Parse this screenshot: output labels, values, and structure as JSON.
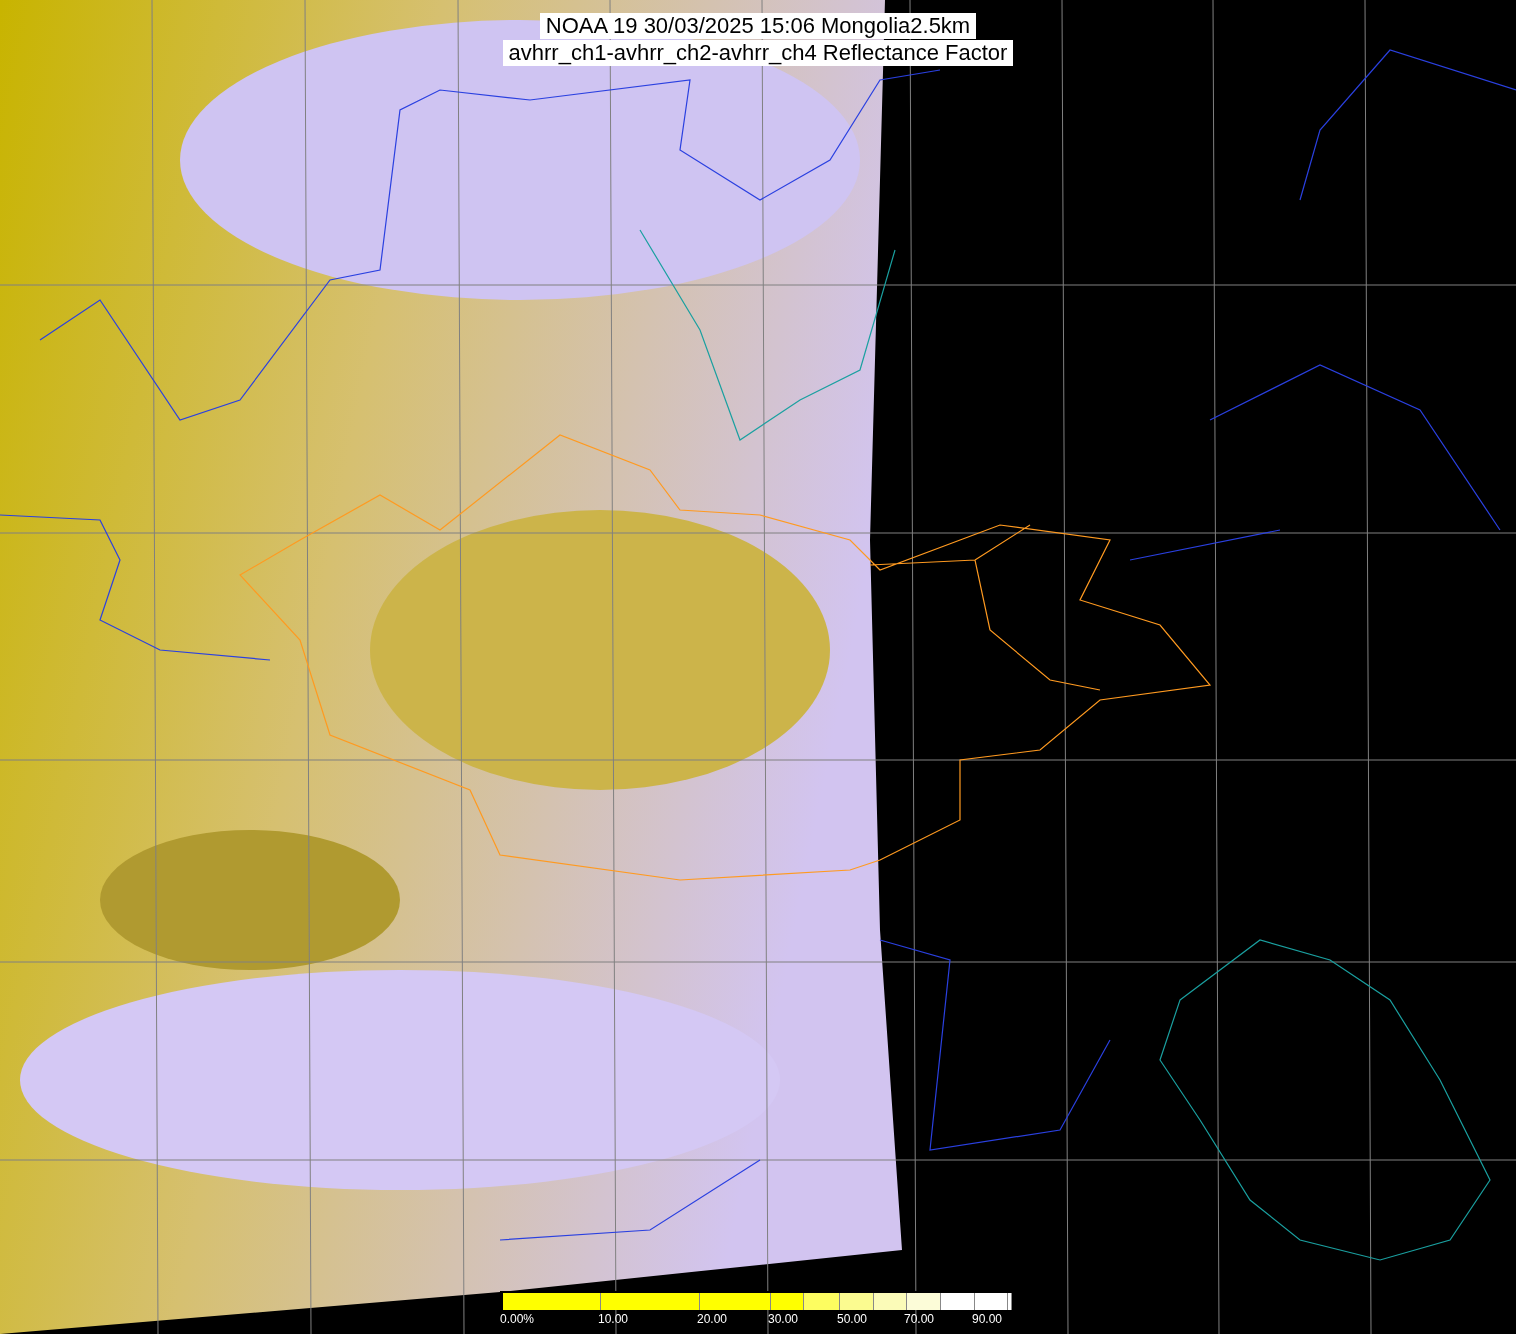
{
  "title_lines": [
    "NOAA 19 30/03/2025 15:06 Mongolia2.5km",
    "avhrr_ch1-avhrr_ch2-avhrr_ch4 Reflectance Factor"
  ],
  "colorbar": {
    "segments": [
      {
        "color": "#ffff00",
        "label": "0.00%"
      },
      {
        "color": "#ffff00",
        "label": "10.00"
      },
      {
        "color": "#ffff00",
        "label": "20.00"
      },
      {
        "color": "#ffff00",
        "label": "30.00"
      },
      {
        "color": "#fdfd60"
      },
      {
        "color": "#fbfb90",
        "label": "50.00"
      },
      {
        "color": "#fbfbb8"
      },
      {
        "color": "#fcfcd8",
        "label": "70.00"
      },
      {
        "color": "#ffffff"
      },
      {
        "color": "#ffffff",
        "label": "90.00"
      },
      {
        "color": "#ffffff"
      }
    ]
  }
}
